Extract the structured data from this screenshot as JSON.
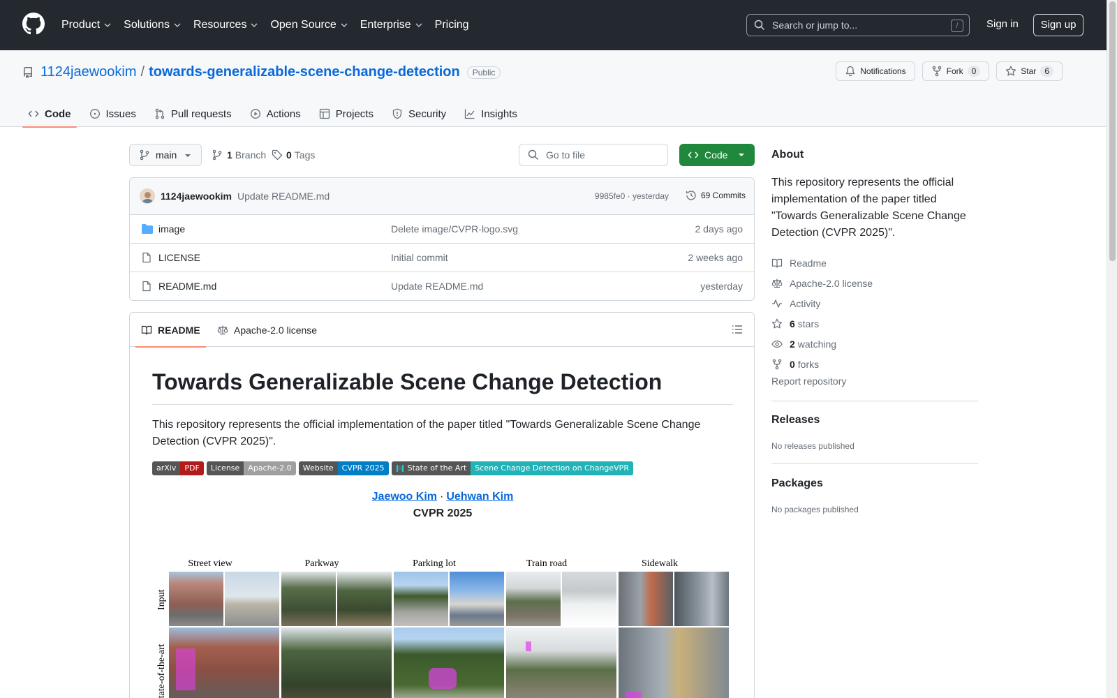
{
  "header": {
    "nav": [
      {
        "label": "Product",
        "has_menu": true
      },
      {
        "label": "Solutions",
        "has_menu": true
      },
      {
        "label": "Resources",
        "has_menu": true
      },
      {
        "label": "Open Source",
        "has_menu": true
      },
      {
        "label": "Enterprise",
        "has_menu": true
      },
      {
        "label": "Pricing",
        "has_menu": false
      }
    ],
    "search_placeholder": "Search or jump to...",
    "search_shortcut": "/",
    "sign_in": "Sign in",
    "sign_up": "Sign up"
  },
  "repo": {
    "owner": "1124jaewookim",
    "separator": "/",
    "name": "towards-generalizable-scene-change-detection",
    "visibility": "Public",
    "notifications_label": "Notifications",
    "fork_label": "Fork",
    "fork_count": "0",
    "star_label": "Star",
    "star_count": "6",
    "tabs": [
      {
        "label": "Code",
        "icon": "code-icon",
        "active": true
      },
      {
        "label": "Issues",
        "icon": "issue-icon",
        "active": false
      },
      {
        "label": "Pull requests",
        "icon": "pull-request-icon",
        "active": false
      },
      {
        "label": "Actions",
        "icon": "play-icon",
        "active": false
      },
      {
        "label": "Projects",
        "icon": "table-icon",
        "active": false
      },
      {
        "label": "Security",
        "icon": "shield-icon",
        "active": false
      },
      {
        "label": "Insights",
        "icon": "graph-icon",
        "active": false
      }
    ]
  },
  "files_toolbar": {
    "branch": "main",
    "branch_count": "1",
    "branch_label": "Branch",
    "tag_count": "0",
    "tag_label": "Tags",
    "goto_placeholder": "Go to file",
    "code_button": "Code"
  },
  "latest_commit": {
    "author": "1124jaewookim",
    "message": "Update README.md",
    "meta": "9985fe0 · yesterday",
    "commits_label": "69 Commits"
  },
  "files": [
    {
      "name": "image",
      "type": "folder",
      "message": "Delete image/CVPR-logo.svg",
      "time": "2 days ago"
    },
    {
      "name": "LICENSE",
      "type": "file",
      "message": "Initial commit",
      "time": "2 weeks ago"
    },
    {
      "name": "README.md",
      "type": "file",
      "message": "Update README.md",
      "time": "yesterday"
    }
  ],
  "readme": {
    "tab_readme": "README",
    "tab_license": "Apache-2.0 license",
    "title": "Towards Generalizable Scene Change Detection",
    "intro": "This repository represents the official implementation of the paper titled \"Towards Generalizable Scene Change Detection (CVPR 2025)\".",
    "badges": [
      {
        "left": "arXiv",
        "right": "PDF",
        "color": "#b31b1b"
      },
      {
        "left": "License",
        "right": "Apache-2.0",
        "color": "#9f9f9f"
      },
      {
        "left": "Website",
        "right": "CVPR 2025",
        "color": "#007ec6"
      },
      {
        "left": "State of the Art",
        "right": "Scene Change Detection on ChangeVPR",
        "color": "#21b3b8"
      }
    ],
    "author_1": "Jaewoo Kim",
    "author_sep": "·",
    "author_2": "Uehwan Kim",
    "venue": "CVPR 2025",
    "figure": {
      "columns": [
        "Street view",
        "Parkway",
        "Parking lot",
        "Train road",
        "Sidewalk"
      ],
      "rows": [
        "Input",
        "State-of-the-art"
      ]
    }
  },
  "about": {
    "heading": "About",
    "description": "This repository represents the official implementation of the paper titled \"Towards Generalizable Scene Change Detection (CVPR 2025)\".",
    "items": [
      {
        "icon": "book-icon",
        "bold": "",
        "label": "Readme"
      },
      {
        "icon": "law-icon",
        "bold": "",
        "label": "Apache-2.0 license"
      },
      {
        "icon": "pulse-icon",
        "bold": "",
        "label": "Activity"
      },
      {
        "icon": "star-icon",
        "bold": "6",
        "label": "stars"
      },
      {
        "icon": "eye-icon",
        "bold": "2",
        "label": "watching"
      },
      {
        "icon": "fork-icon",
        "bold": "0",
        "label": "forks"
      }
    ],
    "report": "Report repository",
    "releases_heading": "Releases",
    "releases_note": "No releases published",
    "packages_heading": "Packages",
    "packages_note": "No packages published"
  },
  "colors": {
    "header_bg": "#24292f",
    "link": "#0969da",
    "primary_button": "#1f883d",
    "active_tab_underline": "#fd8c73"
  }
}
